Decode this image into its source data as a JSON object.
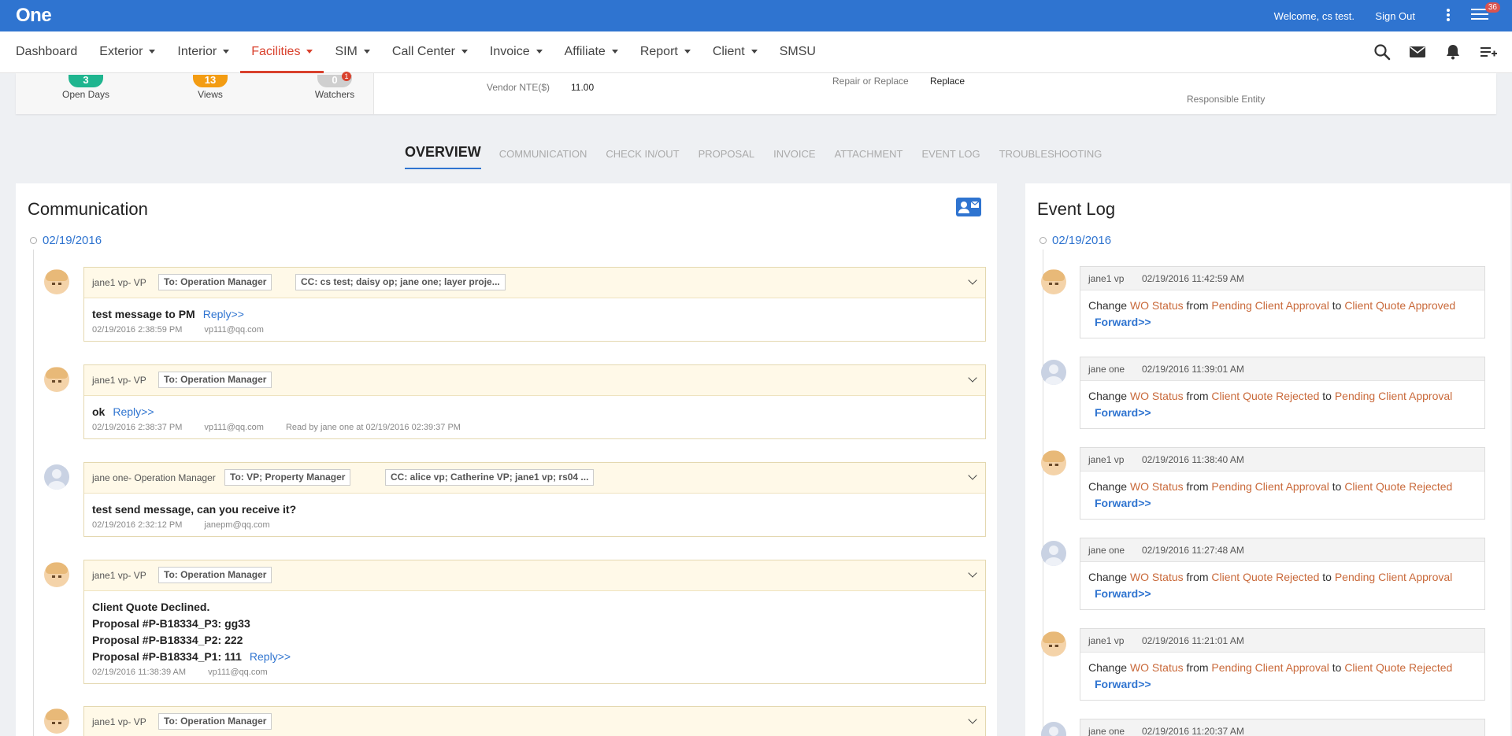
{
  "topbar": {
    "logo": "One",
    "welcome": "Welcome, cs test.",
    "signout": "Sign Out",
    "menu_badge": "36"
  },
  "nav": {
    "items": [
      {
        "label": "Dashboard"
      },
      {
        "label": "Exterior"
      },
      {
        "label": "Interior"
      },
      {
        "label": "Facilities"
      },
      {
        "label": "SIM"
      },
      {
        "label": "Call Center"
      },
      {
        "label": "Invoice"
      },
      {
        "label": "Affiliate"
      },
      {
        "label": "Report"
      },
      {
        "label": "Client"
      },
      {
        "label": "SMSU"
      }
    ],
    "icons": [
      "search-icon",
      "mail-icon",
      "bell-icon",
      "add-list-icon"
    ]
  },
  "summary": {
    "open_days": {
      "value": "3",
      "label": "Open Days"
    },
    "views": {
      "value": "13",
      "label": "Views"
    },
    "watchers": {
      "value": "0",
      "label": "Watchers",
      "dot": "1"
    },
    "vendor_nte_label": "Vendor NTE($)",
    "vendor_nte_value": "11.00",
    "repair_label": "Repair or Replace",
    "repair_value": "Replace",
    "responsible_label": "Responsible Entity"
  },
  "tabs": [
    "OVERVIEW",
    "COMMUNICATION",
    "CHECK IN/OUT",
    "PROPOSAL",
    "INVOICE",
    "ATTACHMENT",
    "EVENT LOG",
    "TROUBLESHOOTING"
  ],
  "communication": {
    "title": "Communication",
    "date": "02/19/2016",
    "reply_label": "Reply>>",
    "messages": [
      {
        "from": "jane1 vp- VP",
        "to": "To: Operation Manager",
        "cc": "CC: cs test; daisy op; jane one; layer proje...",
        "lines": [
          "test message to PM"
        ],
        "time": "02/19/2016 2:38:59 PM",
        "email": "vp111@qq.com",
        "read": ""
      },
      {
        "from": "jane1 vp- VP",
        "to": "To: Operation Manager",
        "cc": "",
        "lines": [
          "ok"
        ],
        "time": "02/19/2016 2:38:37 PM",
        "email": "vp111@qq.com",
        "read": "Read by jane one at 02/19/2016 02:39:37 PM"
      },
      {
        "from": "jane one- Operation Manager",
        "to": "To: VP; Property Manager",
        "cc": "CC: alice vp; Catherine VP; jane1 vp; rs04 ...",
        "lines": [
          "test send message, can you receive it?"
        ],
        "time": "02/19/2016 2:32:12 PM",
        "email": "janepm@qq.com",
        "read": ""
      },
      {
        "from": "jane1 vp- VP",
        "to": "To: Operation Manager",
        "cc": "",
        "lines": [
          "Client Quote Declined.",
          "Proposal #P-B18334_P3: gg33",
          "Proposal #P-B18334_P2: 222",
          "Proposal #P-B18334_P1: 111"
        ],
        "time": "02/19/2016 11:38:39 AM",
        "email": "vp111@qq.com",
        "read": ""
      },
      {
        "from": "jane1 vp- VP",
        "to": "To: Operation Manager",
        "cc": "",
        "lines": [],
        "time": "",
        "email": "",
        "read": ""
      }
    ]
  },
  "event_log": {
    "title": "Event Log",
    "date": "02/19/2016",
    "change_word": "Change",
    "field": "WO Status",
    "from_word": "from",
    "to_word": "to",
    "forward_label": "Forward>>",
    "events": [
      {
        "user": "jane1 vp",
        "time": "02/19/2016 11:42:59 AM",
        "from": "Pending Client Approval",
        "to": "Client Quote Approved"
      },
      {
        "user": "jane one",
        "time": "02/19/2016 11:39:01 AM",
        "from": "Client Quote Rejected",
        "to": "Pending Client Approval"
      },
      {
        "user": "jane1 vp",
        "time": "02/19/2016 11:38:40 AM",
        "from": "Pending Client Approval",
        "to": "Client Quote Rejected"
      },
      {
        "user": "jane one",
        "time": "02/19/2016 11:27:48 AM",
        "from": "Client Quote Rejected",
        "to": "Pending Client Approval"
      },
      {
        "user": "jane1 vp",
        "time": "02/19/2016 11:21:01 AM",
        "from": "Pending Client Approval",
        "to": "Client Quote Rejected"
      },
      {
        "user": "jane one",
        "time": "02/19/2016 11:20:37 AM",
        "from": "",
        "to": ""
      }
    ]
  },
  "colors": {
    "brand": "#2f74d0",
    "active_nav": "#d9412d",
    "open_days_pill": "#1fb58f",
    "views_pill": "#f39c12",
    "watchers_pill": "#cfcfcf",
    "status_highlight": "#c9693a"
  }
}
